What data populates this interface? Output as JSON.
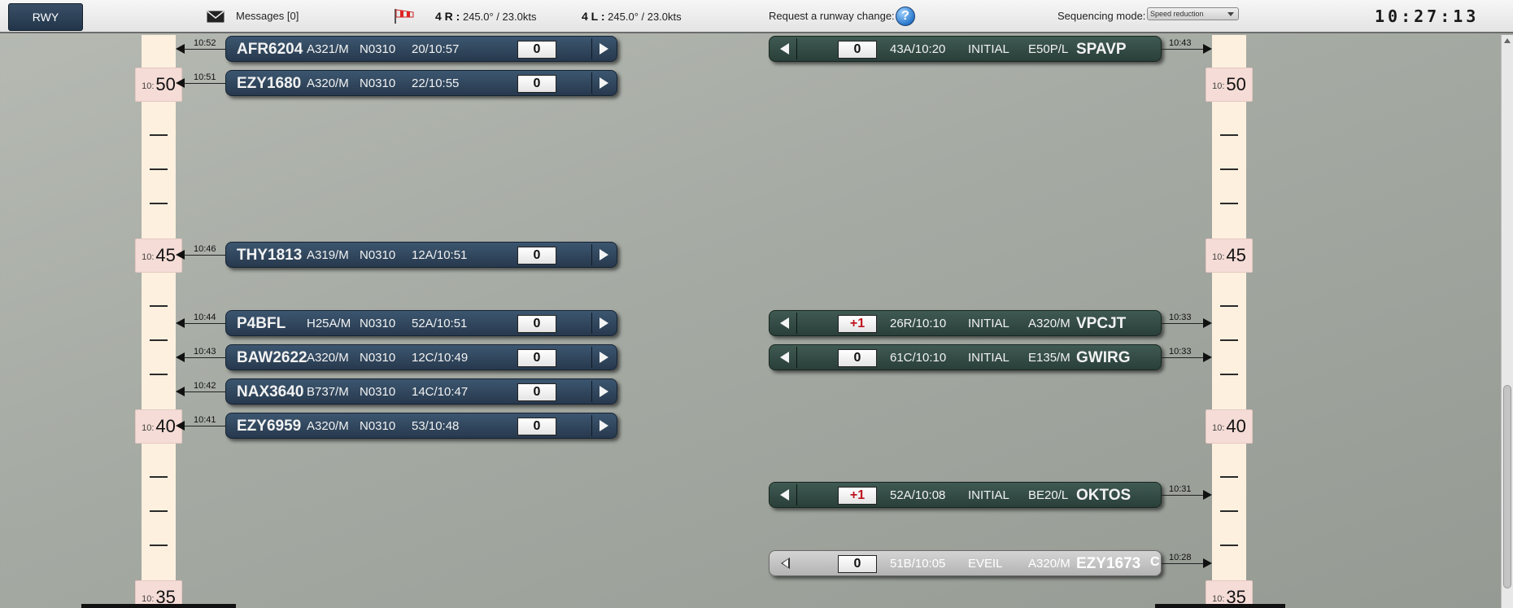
{
  "topbar": {
    "rwy_label": "RWY",
    "messages_label": "Messages [0]",
    "wind": [
      {
        "runway": "4 R :",
        "value": "245.0° / 23.0kts"
      },
      {
        "runway": "4 L :",
        "value": "245.0° / 23.0kts"
      }
    ],
    "runway_change_label": "Request a runway change:",
    "help_symbol": "?",
    "sequencing_label": "Sequencing mode:",
    "sequencing_value": "Speed reduction",
    "clock": "10:27:13"
  },
  "timeline_marks": {
    "hour": "10:",
    "m50": "50",
    "m45": "45",
    "m40": "40",
    "m35": "35"
  },
  "arrivals": [
    {
      "time": "10:52",
      "callsign": "AFR6204",
      "type": "A321/M",
      "route": "N0310",
      "slot": "20/10:57",
      "counter": "0"
    },
    {
      "time": "10:51",
      "callsign": "EZY1680",
      "type": "A320/M",
      "route": "N0310",
      "slot": "22/10:55",
      "counter": "0"
    },
    {
      "time": "10:46",
      "callsign": "THY1813",
      "type": "A319/M",
      "route": "N0310",
      "slot": "12A/10:51",
      "counter": "0"
    },
    {
      "time": "10:44",
      "callsign": "P4BFL",
      "type": "H25A/M",
      "route": "N0310",
      "slot": "52A/10:51",
      "counter": "0"
    },
    {
      "time": "10:43",
      "callsign": "BAW2622",
      "type": "A320/M",
      "route": "N0310",
      "slot": "12C/10:49",
      "counter": "0"
    },
    {
      "time": "10:42",
      "callsign": "NAX3640",
      "type": "B737/M",
      "route": "N0310",
      "slot": "14C/10:47",
      "counter": "0"
    },
    {
      "time": "10:41",
      "callsign": "EZY6959",
      "type": "A320/M",
      "route": "N0310",
      "slot": "53/10:48",
      "counter": "0"
    }
  ],
  "departures": [
    {
      "time": "10:43",
      "counter": "0",
      "slot": "43A/10:20",
      "status": "INITIAL",
      "type": "E50P/L",
      "callsign": "SPAVP"
    },
    {
      "time": "10:33",
      "counter": "+1",
      "slot": "26R/10:10",
      "status": "INITIAL",
      "type": "A320/M",
      "callsign": "VPCJT"
    },
    {
      "time": "10:33",
      "counter": "0",
      "slot": "61C/10:10",
      "status": "INITIAL",
      "type": "E135/M",
      "callsign": "GWIRG"
    },
    {
      "time": "10:31",
      "counter": "+1",
      "slot": "52A/10:08",
      "status": "INITIAL",
      "type": "BE20/L",
      "callsign": "OKTOS"
    },
    {
      "time": "10:28",
      "counter": "0",
      "slot": "51B/10:05",
      "status": "EVEIL",
      "type": "A320/M",
      "callsign": "EZY1673",
      "flag": "C"
    }
  ]
}
